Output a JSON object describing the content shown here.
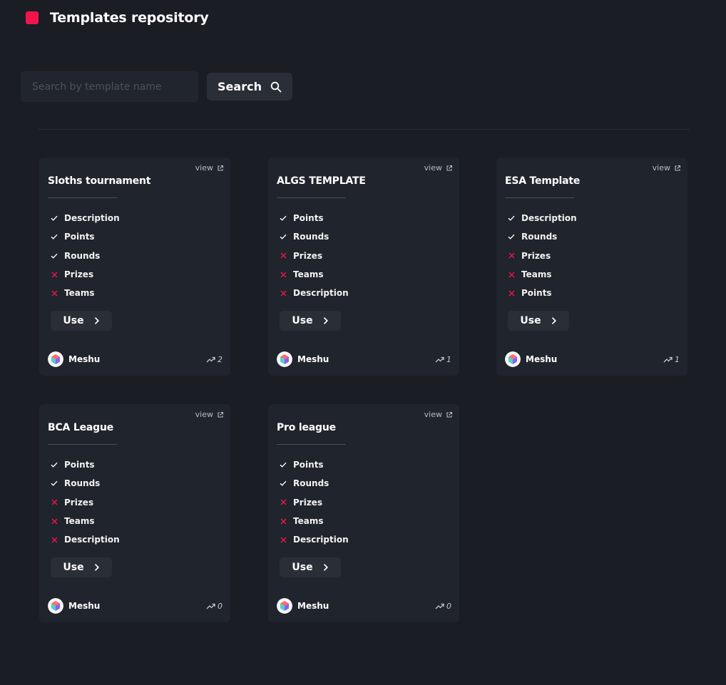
{
  "header": {
    "title": "Templates repository",
    "accent_color": "#f0144b"
  },
  "search": {
    "placeholder": "Search by template name",
    "value": "",
    "button_label": "Search"
  },
  "card_labels": {
    "view": "view",
    "use": "Use"
  },
  "colors": {
    "check": "#ffffff",
    "cross": "#f0144b",
    "background": "#1a1d24",
    "card": "#20242c"
  },
  "cards": [
    {
      "title": "Sloths tournament",
      "features": [
        {
          "label": "Description",
          "included": true
        },
        {
          "label": "Points",
          "included": true
        },
        {
          "label": "Rounds",
          "included": true
        },
        {
          "label": "Prizes",
          "included": false
        },
        {
          "label": "Teams",
          "included": false
        }
      ],
      "author": "Meshu",
      "uses": "2"
    },
    {
      "title": "ALGS TEMPLATE",
      "features": [
        {
          "label": "Points",
          "included": true
        },
        {
          "label": "Rounds",
          "included": true
        },
        {
          "label": "Prizes",
          "included": false
        },
        {
          "label": "Teams",
          "included": false
        },
        {
          "label": "Description",
          "included": false
        }
      ],
      "author": "Meshu",
      "uses": "1"
    },
    {
      "title": "ESA Template",
      "features": [
        {
          "label": "Description",
          "included": true
        },
        {
          "label": "Rounds",
          "included": true
        },
        {
          "label": "Prizes",
          "included": false
        },
        {
          "label": "Teams",
          "included": false
        },
        {
          "label": "Points",
          "included": false
        }
      ],
      "author": "Meshu",
      "uses": "1"
    },
    {
      "title": "BCA League",
      "features": [
        {
          "label": "Points",
          "included": true
        },
        {
          "label": "Rounds",
          "included": true
        },
        {
          "label": "Prizes",
          "included": false
        },
        {
          "label": "Teams",
          "included": false
        },
        {
          "label": "Description",
          "included": false
        }
      ],
      "author": "Meshu",
      "uses": "0"
    },
    {
      "title": "Pro league",
      "features": [
        {
          "label": "Points",
          "included": true
        },
        {
          "label": "Rounds",
          "included": true
        },
        {
          "label": "Prizes",
          "included": false
        },
        {
          "label": "Teams",
          "included": false
        },
        {
          "label": "Description",
          "included": false
        }
      ],
      "author": "Meshu",
      "uses": "0"
    }
  ]
}
